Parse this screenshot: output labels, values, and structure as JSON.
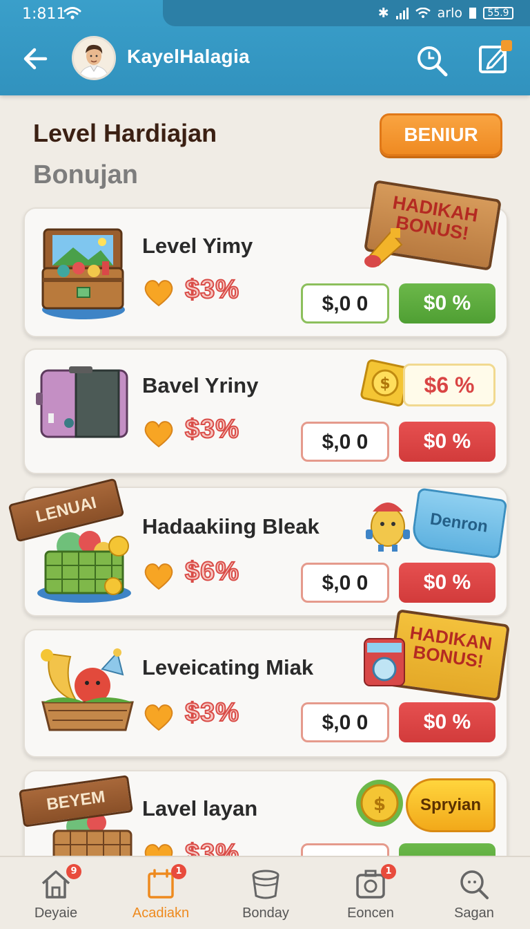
{
  "status_bar": {
    "time": "1:811",
    "carrier": "arlo",
    "battery": "55.9"
  },
  "header": {
    "username": "KayelHalagia"
  },
  "page": {
    "title": "Level Hardiajan",
    "subtitle": "Bonujan",
    "action_label": "BENIUR"
  },
  "cards": [
    {
      "title": "Level Yimy",
      "percent": "$3%",
      "outline_label": "$,0 0",
      "fill_label": "$0 %",
      "accent": "green",
      "sign_text": "HADIKAH BONUS!"
    },
    {
      "title": "Bavel Yriny",
      "percent": "$3%",
      "outline_label": "$,0 0",
      "fill_label": "$0 %",
      "accent": "red",
      "price_tag": "$6 %"
    },
    {
      "title": "Hadaakiing Bleak",
      "percent": "$6%",
      "outline_label": "$,0 0",
      "fill_label": "$0 %",
      "accent": "red",
      "ribbon": "LENUAI",
      "tag": "Denron"
    },
    {
      "title": "Leveicating Miak",
      "percent": "$3%",
      "outline_label": "$,0 0",
      "fill_label": "$0 %",
      "accent": "red",
      "sign_text": "HADIKAN BONUS!"
    },
    {
      "title": "Lavel layan",
      "percent": "$3%",
      "accent": "green",
      "ribbon": "BEYEM",
      "tag": "Spryian"
    }
  ],
  "bottom_nav": {
    "items": [
      {
        "label": "Deyaie",
        "icon": "home-icon",
        "badge": "9"
      },
      {
        "label": "Acadiakn",
        "icon": "calendar-icon",
        "badge": "1",
        "active": true
      },
      {
        "label": "Bonday",
        "icon": "bucket-icon"
      },
      {
        "label": "Eoncen",
        "icon": "camera-icon",
        "badge": "1"
      },
      {
        "label": "Sagan",
        "icon": "search-icon"
      }
    ]
  },
  "colors": {
    "header": "#3a9fca",
    "accent_orange": "#ef8a22",
    "green": "#5aa83c",
    "red": "#d94444"
  }
}
